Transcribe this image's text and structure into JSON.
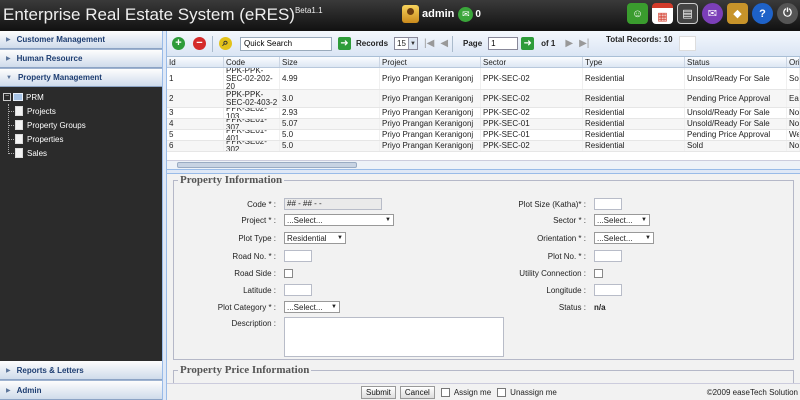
{
  "header": {
    "title": "Enterprise Real Estate System (eRES)",
    "version": "Beta1.1",
    "user": "admin",
    "message_count": "0",
    "tools": [
      {
        "name": "chat-icon",
        "color": "#3a9c2e",
        "glyph": "☺"
      },
      {
        "name": "calendar-icon",
        "color": "#d23b2b",
        "glyph": "▦"
      },
      {
        "name": "calculator-icon",
        "color": "#444444",
        "glyph": "▤"
      },
      {
        "name": "messenger-icon",
        "color": "#7b3fb8",
        "glyph": "✉"
      },
      {
        "name": "badge-icon",
        "color": "#c7932a",
        "glyph": "◆"
      },
      {
        "name": "help-icon",
        "color": "#1e62c8",
        "glyph": "?"
      },
      {
        "name": "power-icon",
        "color": "#666666",
        "glyph": "⏻"
      }
    ]
  },
  "sidebar": {
    "sections": [
      "Customer Management",
      "Human Resource",
      "Property Management"
    ],
    "tree": {
      "root": "PRM",
      "children": [
        "Projects",
        "Property Groups",
        "Properties",
        "Sales"
      ]
    },
    "bottom_sections": [
      "Reports & Letters",
      "Admin"
    ]
  },
  "toolbar": {
    "quick_search": "Quick Search",
    "records_label": "Records",
    "records_value": "15",
    "page_label": "Page",
    "page_value": "1",
    "of_label": "of 1",
    "total_records_label": "Total Records: 10"
  },
  "grid": {
    "columns": [
      "Id",
      "Code",
      "Size",
      "Project",
      "Sector",
      "Type",
      "Status",
      "Ori"
    ],
    "rows": [
      {
        "id": "1",
        "code": "PPK-PPK-\nSEC-02-202-20",
        "size": "4.99",
        "project": "Priyo Prangan Keranigonj",
        "sector": "PPK-SEC-02",
        "type": "Residential",
        "status": "Unsold/Ready For Sale",
        "ori": "Sou"
      },
      {
        "id": "2",
        "code": "PPK-PPK-\nSEC-02-403-2",
        "size": "3.0",
        "project": "Priyo Prangan Keranigonj",
        "sector": "PPK-SEC-02",
        "type": "Residential",
        "status": "Pending Price Approval",
        "ori": "Eas"
      },
      {
        "id": "3",
        "code": "PPK-SE02-103",
        "size": "2.93",
        "project": "Priyo Prangan Keranigonj",
        "sector": "PPK-SEC-02",
        "type": "Residential",
        "status": "Unsold/Ready For Sale",
        "ori": "Nor"
      },
      {
        "id": "4",
        "code": "PPK-SE01-307",
        "size": "5.07",
        "project": "Priyo Prangan Keranigonj",
        "sector": "PPK-SEC-01",
        "type": "Residential",
        "status": "Unsold/Ready For Sale",
        "ori": "Nor"
      },
      {
        "id": "5",
        "code": "PPK-SE01-401",
        "size": "5.0",
        "project": "Priyo Prangan Keranigonj",
        "sector": "PPK-SEC-01",
        "type": "Residential",
        "status": "Pending Price Approval",
        "ori": "We"
      },
      {
        "id": "6",
        "code": "PPK-SE02-302",
        "size": "5.0",
        "project": "Priyo Prangan Keranigonj",
        "sector": "PPK-SEC-02",
        "type": "Residential",
        "status": "Sold",
        "ori": "Nor"
      }
    ]
  },
  "form": {
    "legend": "Property Information",
    "legend2": "Property Price Information",
    "code_label": "Code * :",
    "code_value": "## - ## -        -",
    "project_label": "Project * :",
    "project_value": "...Select...",
    "plot_type_label": "Plot Type :",
    "plot_type_value": "Residential",
    "road_no_label": "Road No. * :",
    "road_side_label": "Road Side :",
    "latitude_label": "Latitude :",
    "plot_category_label": "Plot Category * :",
    "plot_category_value": "...Select...",
    "description_label": "Description :",
    "plot_size_label": "Plot Size (Katha)* :",
    "sector_label": "Sector * :",
    "sector_value": "...Select...",
    "orientation_label": "Orientation * :",
    "orientation_value": "...Select...",
    "plot_no_label": "Plot No. * :",
    "utility_label": "Utility Connection :",
    "longitude_label": "Longitude :",
    "status_label": "Status :",
    "status_value": "n/a"
  },
  "footer": {
    "submit": "Submit",
    "cancel": "Cancel",
    "assign": "Assign me",
    "unassign": "Unassign me",
    "copyright": "©2009 easeTech Solution"
  }
}
